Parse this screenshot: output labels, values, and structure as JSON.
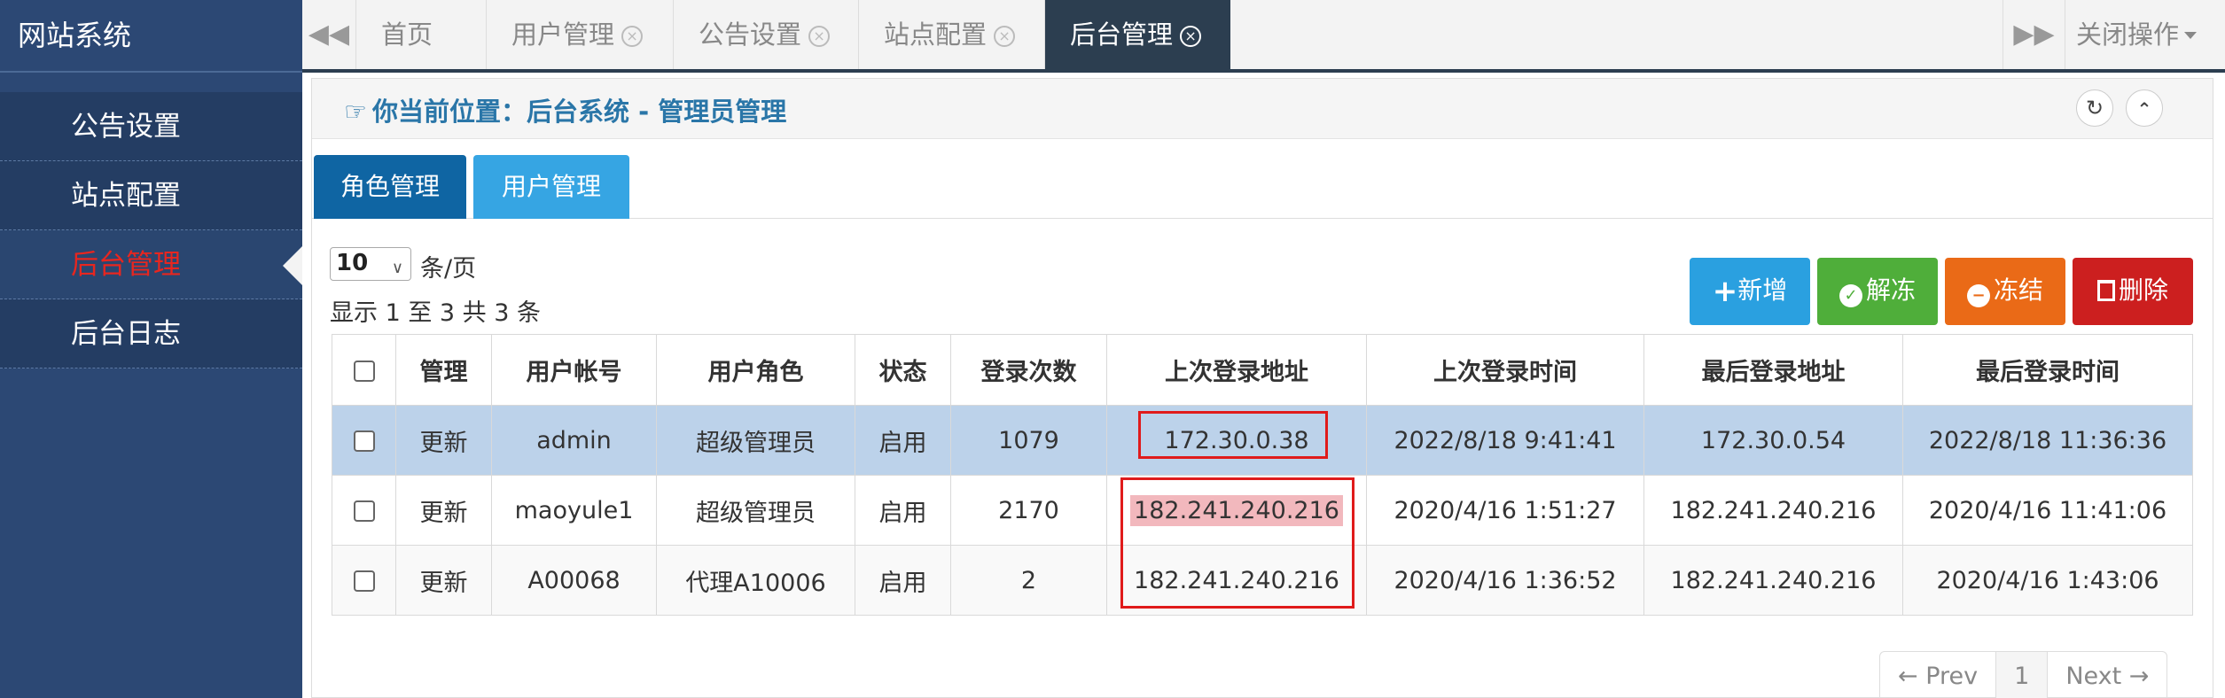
{
  "app": {
    "title": "网站系统"
  },
  "sidebar": {
    "items": [
      {
        "label": "公告设置"
      },
      {
        "label": "站点配置"
      },
      {
        "label": "后台管理"
      },
      {
        "label": "后台日志"
      }
    ]
  },
  "topbar": {
    "prev_icon": "double-left-arrow",
    "next_icon": "double-right-arrow",
    "tabs": [
      {
        "label": "首页"
      },
      {
        "label": "用户管理"
      },
      {
        "label": "公告设置"
      },
      {
        "label": "站点配置"
      },
      {
        "label": "后台管理"
      }
    ],
    "close_ops": "关闭操作"
  },
  "breadcrumb": {
    "text": "你当前位置：后台系统 - 管理员管理"
  },
  "inner_tabs": [
    {
      "label": "角色管理"
    },
    {
      "label": "用户管理"
    }
  ],
  "page_size": {
    "value": "10",
    "suffix": "条/页"
  },
  "summary": "显示 1 至 3 共 3 条",
  "actions": {
    "add": "新增",
    "unfreeze": "解冻",
    "freeze": "冻结",
    "delete": "删除"
  },
  "colors": {
    "sidebar_bg": "#2c4874",
    "active_menu_text": "#e8261f",
    "add": "#2aa0e0",
    "unfreeze": "#4fae3a",
    "freeze": "#ea6a17",
    "delete": "#cc1f1f",
    "selected_row": "#bcd2ea",
    "annotation_box": "#e01b1b"
  },
  "table": {
    "headers": [
      "管理",
      "用户帐号",
      "用户角色",
      "状态",
      "登录次数",
      "上次登录地址",
      "上次登录时间",
      "最后登录地址",
      "最后登录时间"
    ],
    "rows": [
      {
        "action": "更新",
        "account": "admin",
        "role": "超级管理员",
        "status": "启用",
        "count": "1079",
        "last_ip": "172.30.0.38",
        "last_time": "2022/8/18 9:41:41",
        "final_ip": "172.30.0.54",
        "final_time": "2022/8/18 11:36:36"
      },
      {
        "action": "更新",
        "account": "maoyule1",
        "role": "超级管理员",
        "status": "启用",
        "count": "2170",
        "last_ip": "182.241.240.216",
        "last_time": "2020/4/16 1:51:27",
        "final_ip": "182.241.240.216",
        "final_time": "2020/4/16 11:41:06"
      },
      {
        "action": "更新",
        "account": "A00068",
        "role": "代理A10006",
        "status": "启用",
        "count": "2",
        "last_ip": "182.241.240.216",
        "last_time": "2020/4/16 1:36:52",
        "final_ip": "182.241.240.216",
        "final_time": "2020/4/16 1:43:06"
      }
    ]
  },
  "pagination": {
    "prev": "← Prev",
    "page": "1",
    "next": "Next →"
  }
}
